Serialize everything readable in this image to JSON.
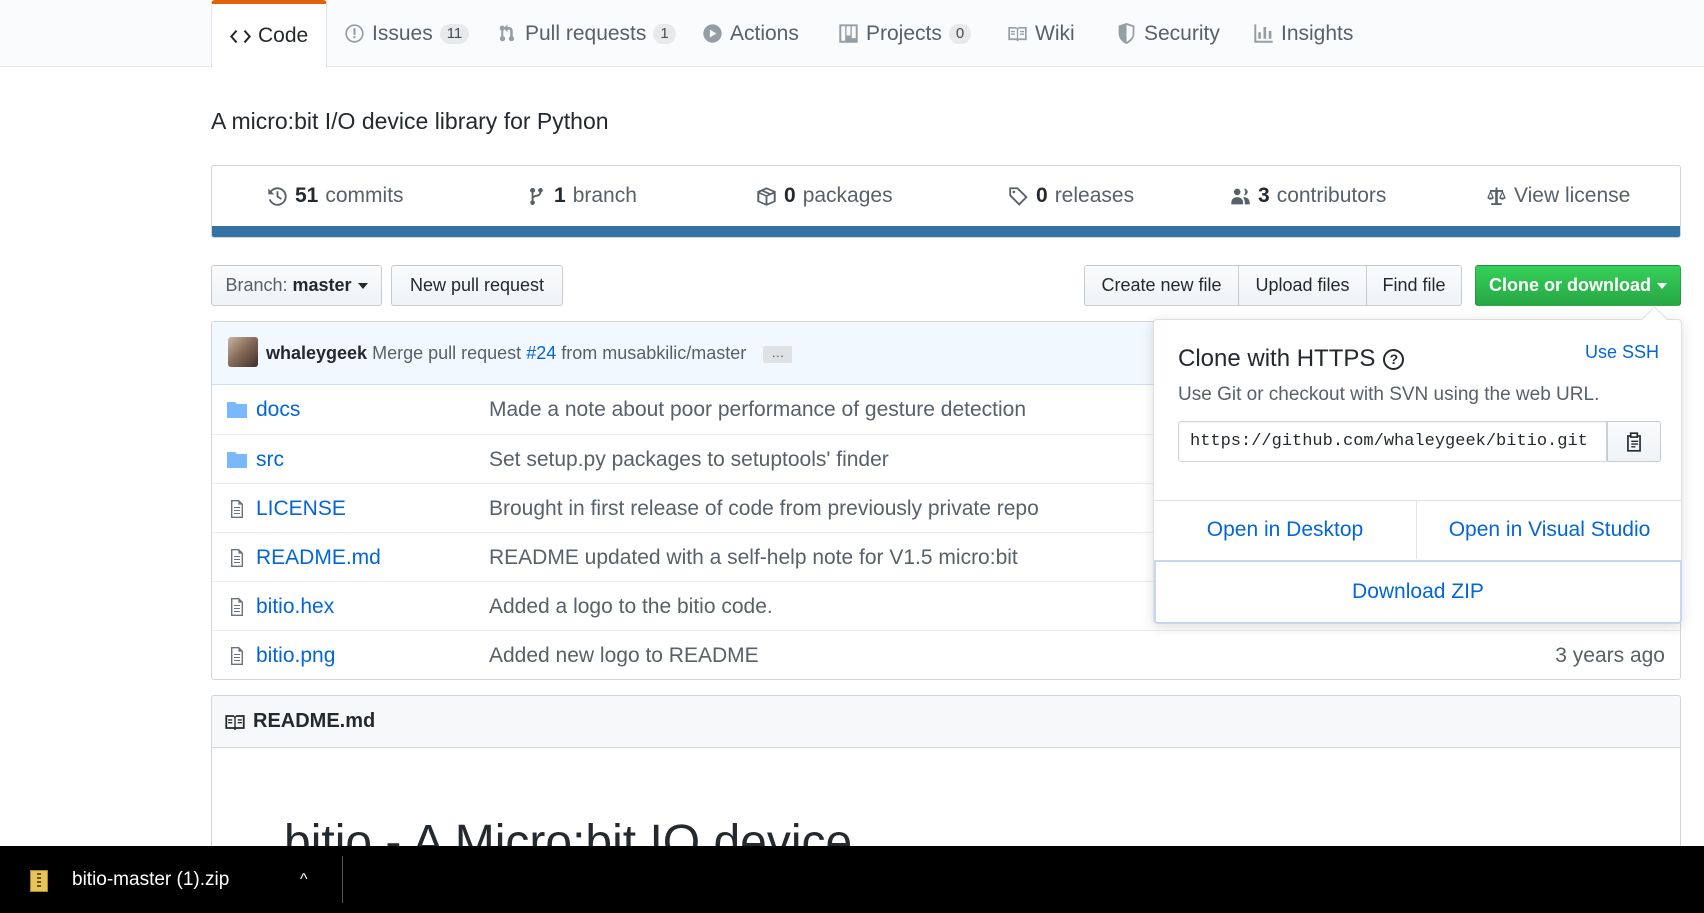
{
  "tabs": [
    {
      "label": "Code",
      "counter": null
    },
    {
      "label": "Issues",
      "counter": "11"
    },
    {
      "label": "Pull requests",
      "counter": "1"
    },
    {
      "label": "Actions",
      "counter": null
    },
    {
      "label": "Projects",
      "counter": "0"
    },
    {
      "label": "Wiki",
      "counter": null
    },
    {
      "label": "Security",
      "counter": null
    },
    {
      "label": "Insights",
      "counter": null
    }
  ],
  "repo": {
    "description": "A micro:bit I/O device library for Python"
  },
  "summary": {
    "commits_num": "51",
    "commits_label": "commits",
    "branch_num": "1",
    "branch_label": "branch",
    "packages_num": "0",
    "packages_label": "packages",
    "releases_num": "0",
    "releases_label": "releases",
    "contributors_num": "3",
    "contributors_label": "contributors",
    "license_label": "View license"
  },
  "toolbar": {
    "branch_prefix": "Branch:",
    "branch_name": "master",
    "new_pr": "New pull request",
    "create_file": "Create new file",
    "upload_files": "Upload files",
    "find_file": "Find file",
    "clone_download": "Clone or download"
  },
  "commit": {
    "author": "whaleygeek",
    "message_prefix": "Merge pull request",
    "pr_link": "#24",
    "message_suffix": "from musabkilic/master",
    "ellipsis": "…"
  },
  "files": [
    {
      "type": "dir",
      "name": "docs",
      "message": "Made a note about poor performance of gesture detection",
      "age": ""
    },
    {
      "type": "dir",
      "name": "src",
      "message": "Set setup.py packages to setuptools' finder",
      "age": ""
    },
    {
      "type": "file",
      "name": "LICENSE",
      "message": "Brought in first release of code from previously private repo",
      "age": ""
    },
    {
      "type": "file",
      "name": "README.md",
      "message": "README updated with a self-help note for V1.5 micro:bit",
      "age": ""
    },
    {
      "type": "file",
      "name": "bitio.hex",
      "message": "Added a logo to the bitio code.",
      "age": ""
    },
    {
      "type": "file",
      "name": "bitio.png",
      "message": "Added new logo to README",
      "age": "3 years ago"
    }
  ],
  "readme": {
    "header": "README.md",
    "title": "bitio - A Micro:bit IO device"
  },
  "clone_popup": {
    "title": "Clone with HTTPS",
    "help": "?",
    "use_ssh": "Use SSH",
    "subtitle": "Use Git or checkout with SVN using the web URL.",
    "url": "https://github.com/whaleygeek/bitio.git",
    "open_desktop": "Open in Desktop",
    "open_vs": "Open in Visual Studio",
    "download_zip": "Download ZIP"
  },
  "download_bar": {
    "filename": "bitio-master (1).zip",
    "chevron": "^"
  },
  "colors": {
    "tab_accent": "#e36209",
    "language_bar": "#3572a5",
    "link": "#0366d6",
    "primary_button": "#2ea44f"
  }
}
